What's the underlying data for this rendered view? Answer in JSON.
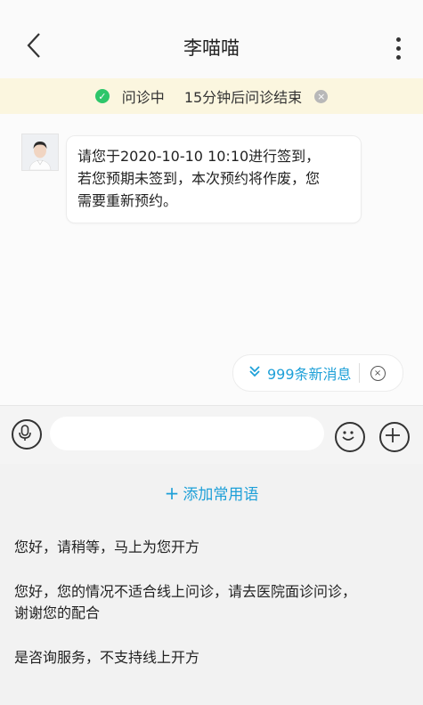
{
  "header": {
    "title": "李喵喵"
  },
  "status": {
    "state": "问诊中",
    "countdown": "15分钟后问诊结束"
  },
  "chat": {
    "messages": [
      {
        "line1": "请您于2020-10-10  10:10进行签到，",
        "line2": "若您预期未签到，本次预约将作废，您",
        "line3": "需要重新预约。"
      }
    ]
  },
  "new_messages": {
    "label": "999条新消息"
  },
  "input": {
    "placeholder": ""
  },
  "phrases_panel": {
    "add_label": "添加常用语",
    "items": [
      "您好，请稍等，马上为您开方",
      "您好，您的情况不适合线上问诊，请去医院面诊问诊，",
      "谢谢您的配合",
      "是咨询服务，不支持线上开方"
    ]
  },
  "colors": {
    "accent": "#1ea0d8",
    "status_bg": "#fbf6df",
    "check": "#2ec66a"
  },
  "icons": [
    "back-icon",
    "more-icon",
    "check-icon",
    "close-icon",
    "double-chevron-down-icon",
    "mic-icon",
    "emoji-icon",
    "plus-icon"
  ]
}
